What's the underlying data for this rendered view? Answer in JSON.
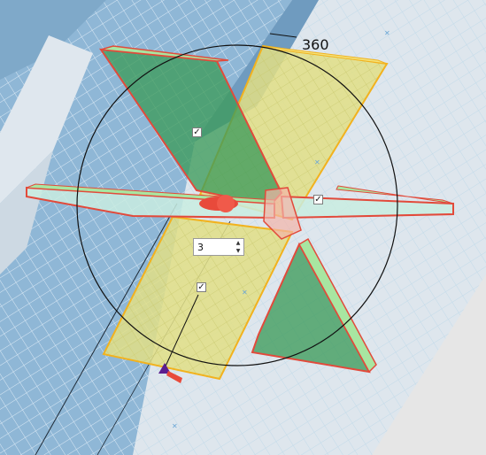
{
  "viewport": {
    "rotation_angle_label": "360",
    "copies_count": "3",
    "checkbox_mark": "✓",
    "spin_up_glyph": "▲",
    "spin_down_glyph": "▼",
    "colors": {
      "background": "#e6e6e6",
      "grid_base": "#8fb7d6",
      "plane_outline": "#e24a3b",
      "green_face": "#3d9b5b",
      "yellow_face": "#e6e07a",
      "gizmo_circle": "#111111",
      "pivot_marker": "#5b1d8f"
    }
  }
}
